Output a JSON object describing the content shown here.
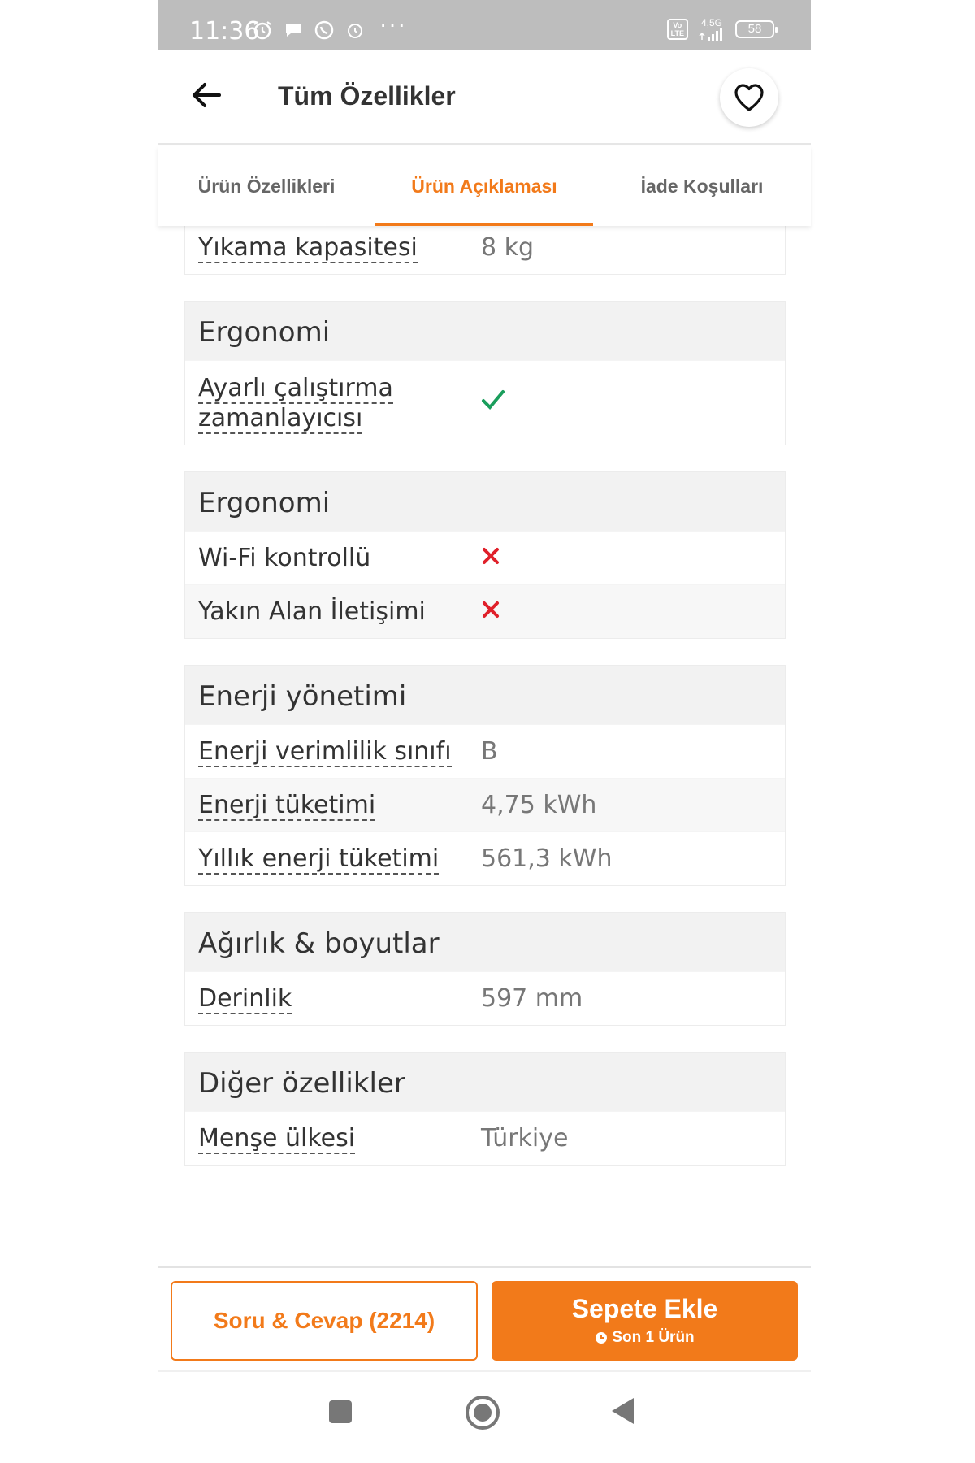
{
  "status_bar": {
    "time": "11:36",
    "dots": "···",
    "volte": "Vo\nLTE",
    "network": "4,5G",
    "battery": "58"
  },
  "header": {
    "title": "Tüm Özellikler",
    "back_icon": "arrow-left-icon",
    "favorite_icon": "heart-outline-icon"
  },
  "tabs": [
    {
      "label": "Ürün Özellikleri",
      "active": false
    },
    {
      "label": "Ürün Açıklaması",
      "active": true
    },
    {
      "label": "İade Koşulları",
      "active": false
    }
  ],
  "partial_row": {
    "label": "Yıkama kapasitesi",
    "value": "8 kg"
  },
  "groups": [
    {
      "title": "Ergonomi",
      "rows": [
        {
          "label": "Ayarlı çalıştırma zamanlayıcısı",
          "value_icon": "check-icon"
        }
      ]
    },
    {
      "title": "Ergonomi",
      "rows": [
        {
          "label": "Wi-Fi kontrollü",
          "value_icon": "cross-icon"
        },
        {
          "label": "Yakın Alan İletişimi",
          "value_icon": "cross-icon"
        }
      ]
    },
    {
      "title": "Enerji yönetimi",
      "rows": [
        {
          "label": "Enerji verimlilik sınıfı",
          "value": "B"
        },
        {
          "label": "Enerji tüketimi",
          "value": "4,75 kWh"
        },
        {
          "label": "Yıllık enerji tüketimi",
          "value": "561,3 kWh"
        }
      ]
    },
    {
      "title": "Ağırlık & boyutlar",
      "rows": [
        {
          "label": "Derinlik",
          "value": "597 mm"
        }
      ]
    },
    {
      "title": "Diğer özellikler",
      "rows": [
        {
          "label": "Menşe ülkesi",
          "value": "Türkiye"
        }
      ]
    }
  ],
  "bottom_bar": {
    "qa_label": "Soru & Cevap (2214)",
    "cart_label": "Sepete Ekle",
    "cart_sub": "Son 1 Ürün"
  },
  "colors": {
    "accent": "#f27a1a",
    "check": "#1a9e5c",
    "cross": "#e0202a",
    "status_bar": "#bdbdbd"
  }
}
